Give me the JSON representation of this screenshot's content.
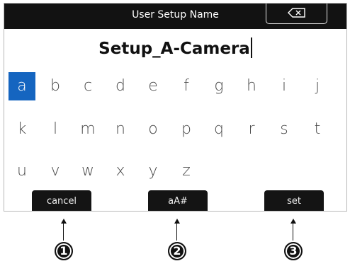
{
  "header": {
    "title": "User Setup Name",
    "backspace_icon": "backspace-icon"
  },
  "entry": {
    "value": "Setup_A-Camera"
  },
  "keyboard": {
    "selected": "a",
    "rows": [
      [
        "a",
        "b",
        "c",
        "d",
        "e",
        "f",
        "g",
        "h",
        "i",
        "j"
      ],
      [
        "k",
        "l",
        "m",
        "n",
        "o",
        "p",
        "q",
        "r",
        "s",
        "t"
      ],
      [
        "u",
        "v",
        "w",
        "x",
        "y",
        "z"
      ]
    ]
  },
  "buttons": {
    "cancel": "cancel",
    "mode": "aA#",
    "set": "set"
  },
  "callouts": [
    "1",
    "2",
    "3"
  ],
  "colors": {
    "bar": "#121212",
    "selected": "#1565c0"
  }
}
